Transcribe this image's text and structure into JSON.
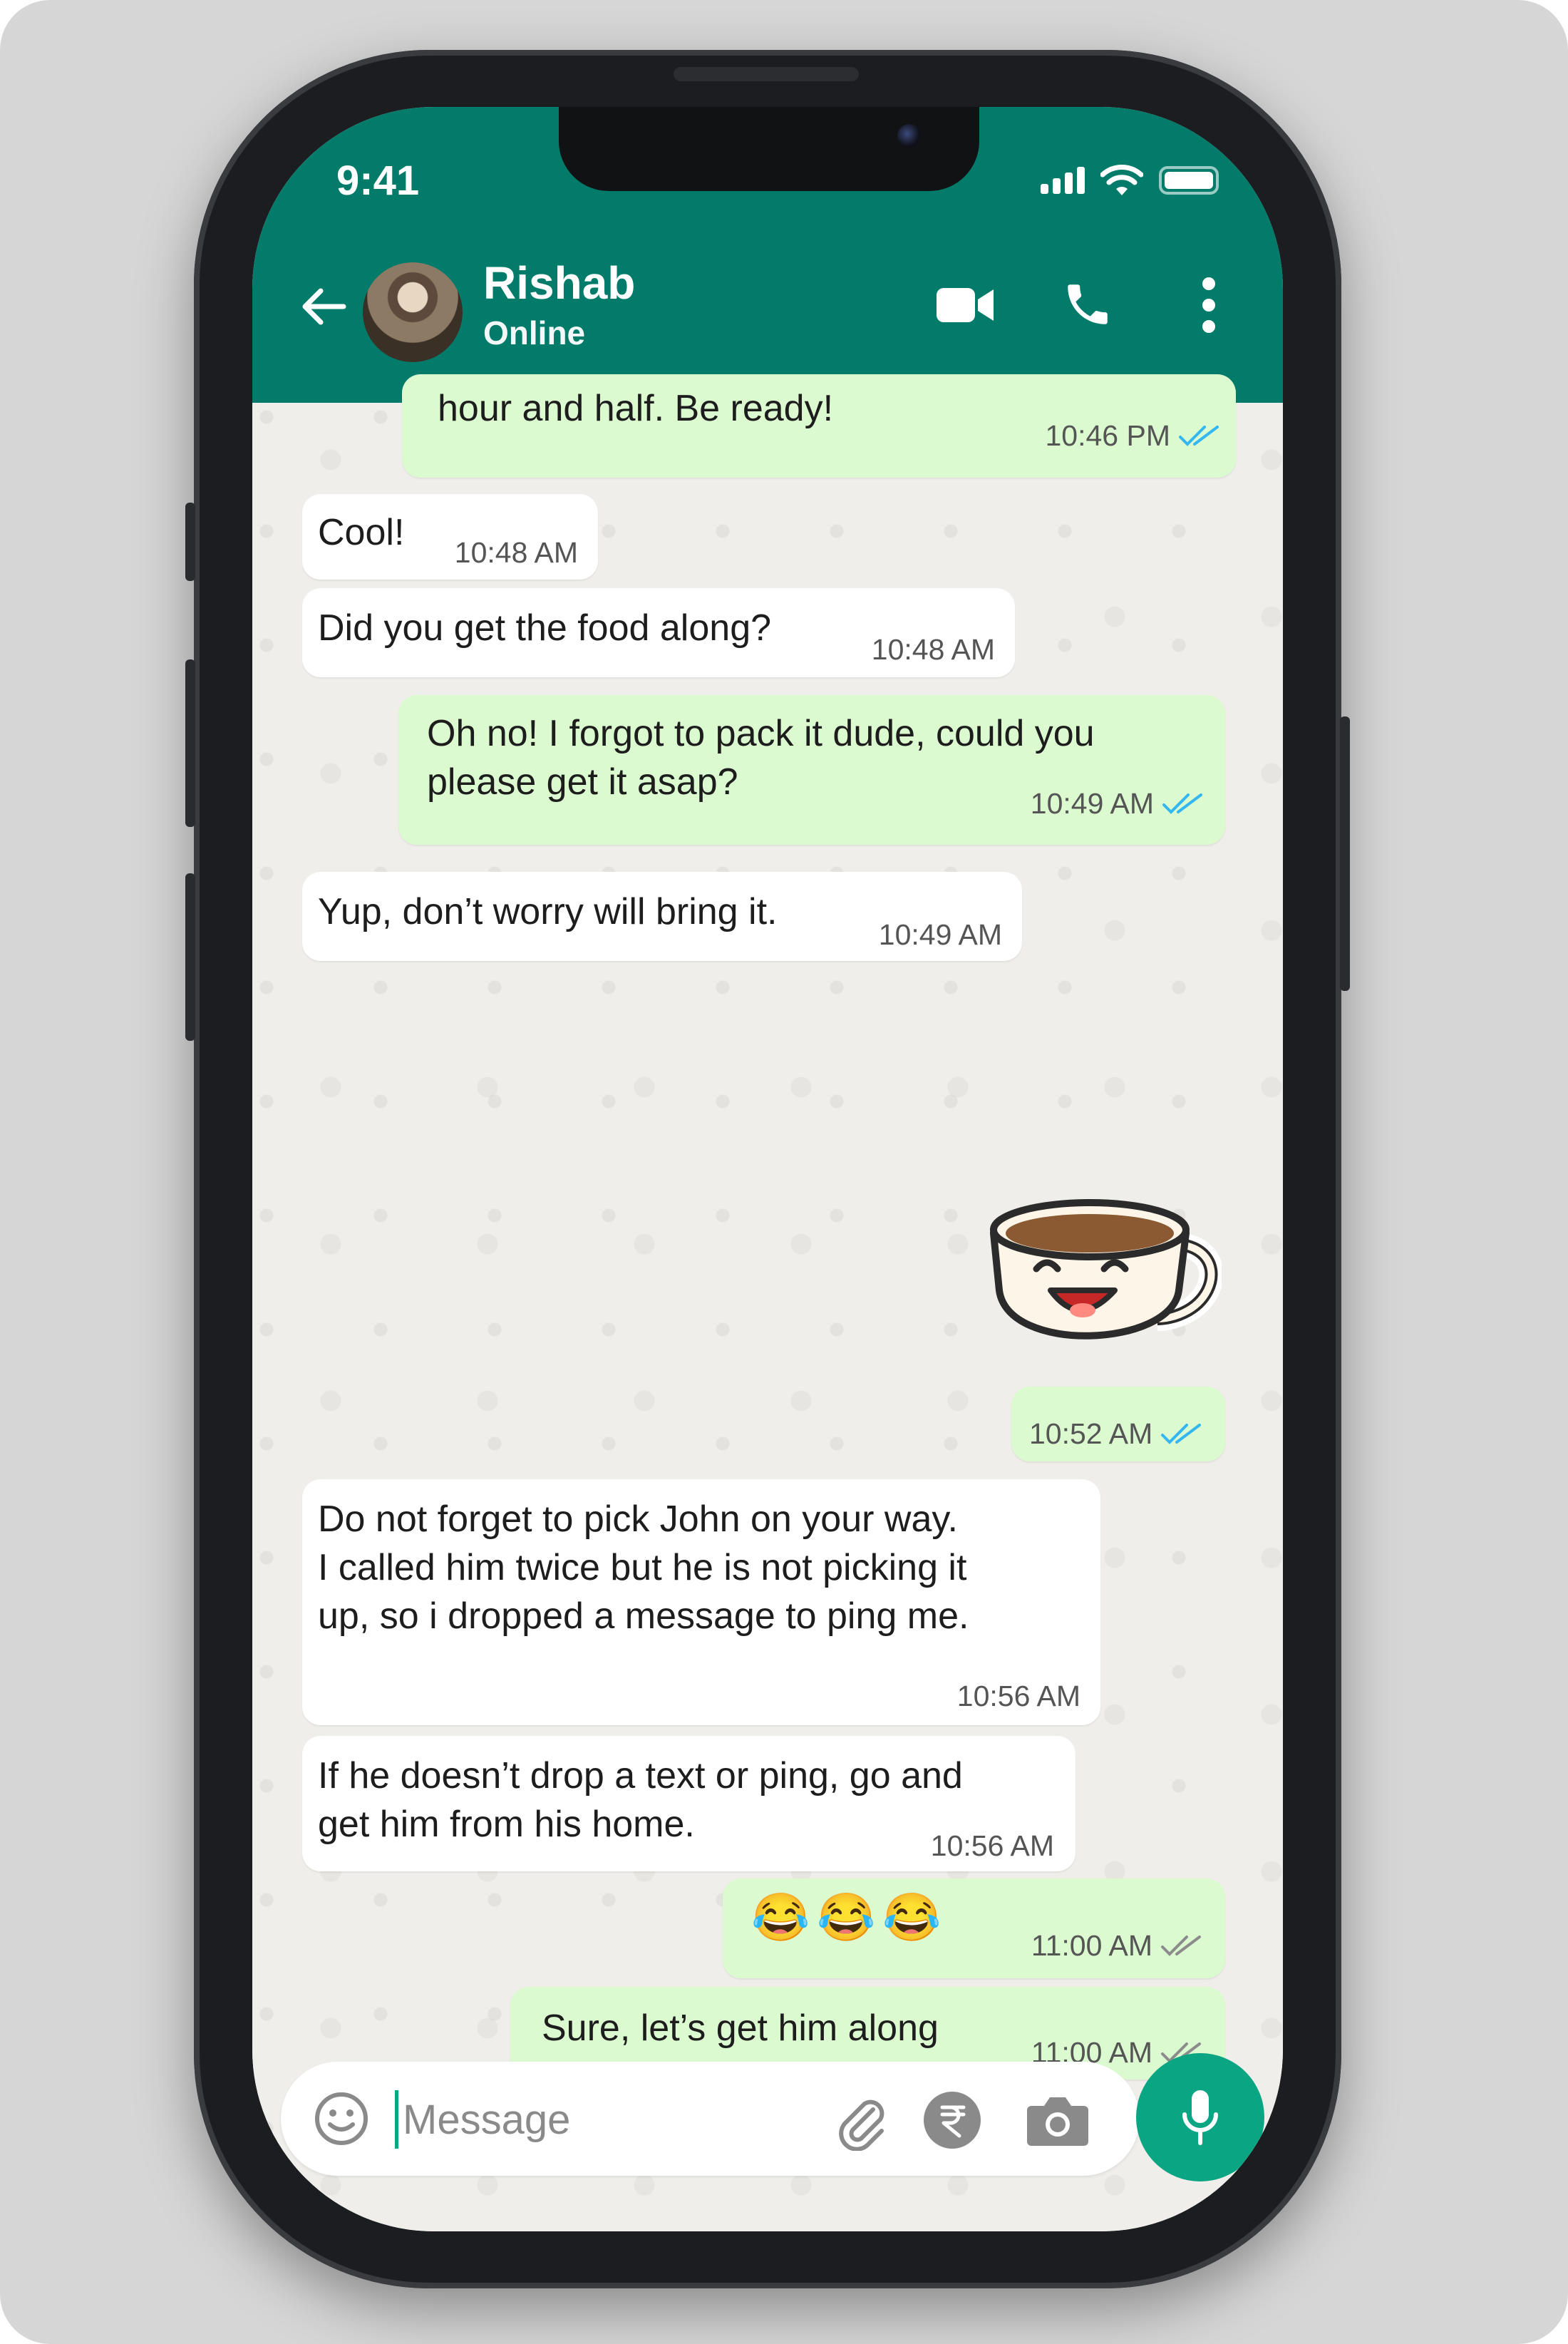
{
  "status_bar": {
    "time": "9:41"
  },
  "header": {
    "contact_name": "Rishab",
    "contact_status": "Online"
  },
  "messages": [
    {
      "side": "out",
      "text": "hour and half. Be ready!",
      "time": "10:46 PM",
      "status": "read"
    },
    {
      "side": "in",
      "text": "Cool!",
      "time": "10:48 AM"
    },
    {
      "side": "in",
      "text": "Did you get the food along?",
      "time": "10:48 AM"
    },
    {
      "side": "out",
      "text": "Oh no! I forgot to pack it dude, could you\nplease get it asap?",
      "time": "10:49 AM",
      "status": "read"
    },
    {
      "side": "in",
      "text": "Yup, don’t worry will bring it.",
      "time": "10:49 AM"
    },
    {
      "side": "out",
      "sticker": "coffee-cup-laughing",
      "time": "10:52 AM",
      "status": "read"
    },
    {
      "side": "in",
      "text": "Do not forget to pick John on your way.\nI called him twice but he is not picking it\nup, so i dropped a message to ping me.",
      "time": "10:56 AM"
    },
    {
      "side": "in",
      "text": "If he doesn’t drop a text or ping, go and\nget him from his home.",
      "time": "10:56 AM"
    },
    {
      "side": "out",
      "text": "😂😂😂",
      "time": "11:00 AM",
      "status": "delivered"
    },
    {
      "side": "out",
      "text": "Sure, let’s get him along",
      "time": "11:00 AM",
      "status": "delivered"
    }
  ],
  "composer": {
    "placeholder": "Message"
  },
  "colors": {
    "header": "#027b6a",
    "outgoing_bubble": "#dcfad0",
    "incoming_bubble": "#ffffff",
    "read_tick": "#34b7f1",
    "delivered_tick": "#8c8c8c",
    "mic_button": "#0aa582"
  },
  "icons": [
    "back-arrow-icon",
    "video-call-icon",
    "phone-icon",
    "more-vert-icon",
    "emoji-icon",
    "attach-icon",
    "rupee-icon",
    "camera-icon",
    "mic-icon"
  ]
}
